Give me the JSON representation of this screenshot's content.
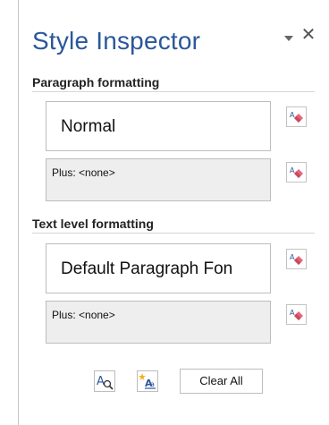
{
  "panel": {
    "title": "Style Inspector",
    "menu_icon": "dropdown-caret-icon",
    "close_icon": "close-icon",
    "close_glyph": "✕"
  },
  "paragraph": {
    "header": "Paragraph formatting",
    "style_value": "Normal",
    "plus_value": "Plus: <none>"
  },
  "text_level": {
    "header": "Text level formatting",
    "style_value": "Default Paragraph Fon",
    "plus_value": "Plus: <none>"
  },
  "bottom": {
    "reveal_icon": "reveal-formatting-icon",
    "new_style_icon": "new-style-icon",
    "clear_all_label": "Clear All"
  },
  "colors": {
    "title": "#2b579a",
    "eraser_pink": "#e8657a"
  }
}
